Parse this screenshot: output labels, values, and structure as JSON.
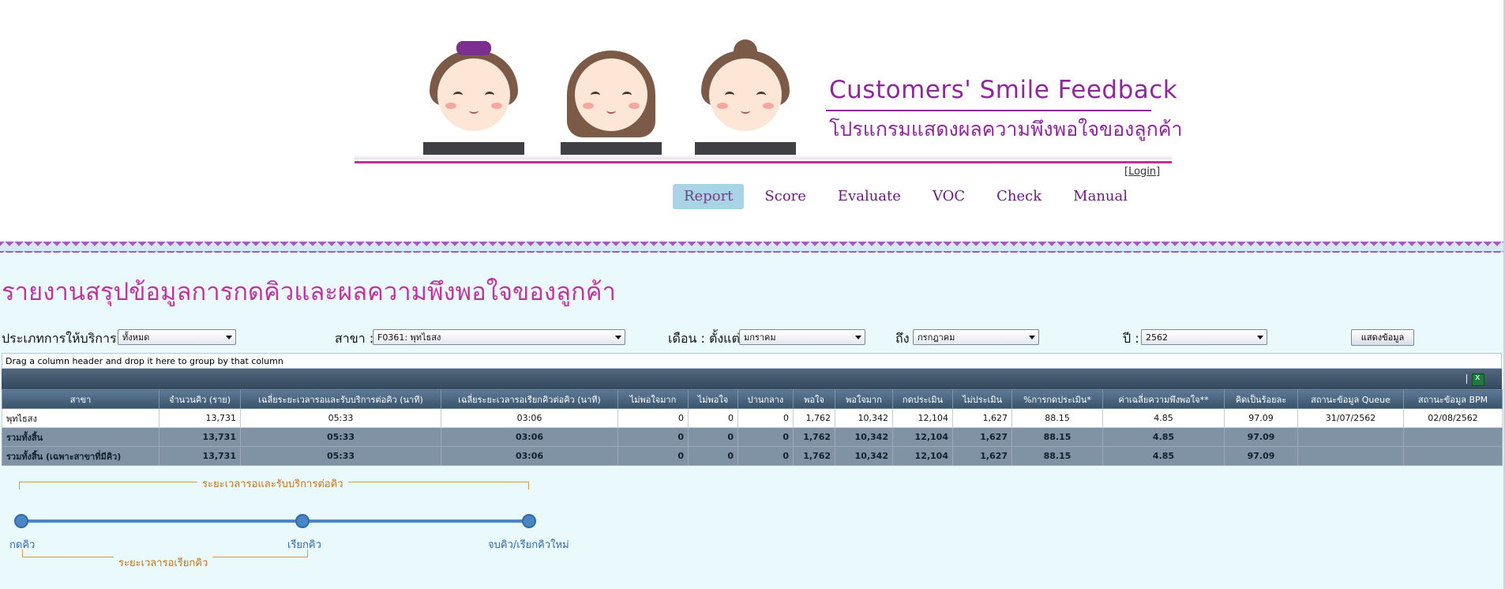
{
  "brand": {
    "title": "Customers' Smile Feedback",
    "subtitle": "โปรแกรมแสดงผลความพึงพอใจของลูกค้า"
  },
  "login": {
    "label": "Login"
  },
  "nav": [
    {
      "label": "Report",
      "active": true
    },
    {
      "label": "Score",
      "active": false
    },
    {
      "label": "Evaluate",
      "active": false
    },
    {
      "label": "VOC",
      "active": false
    },
    {
      "label": "Check",
      "active": false
    },
    {
      "label": "Manual",
      "active": false
    }
  ],
  "page": {
    "title": "รายงานสรุปข้อมูลการกดคิวและผลความพึงพอใจของลูกค้า"
  },
  "filters": {
    "service_type_label": "ประเภทการให้บริการ :",
    "service_type_value": "ทั้งหมด",
    "branch_label": "สาขา :",
    "branch_value": "F0361: พุทไธสง",
    "month_from_label": "เดือน : ตั้งแต่",
    "month_from_value": "มกราคม",
    "month_to_label": "ถึง",
    "month_to_value": "กรกฎาคม",
    "year_label": "ปี :",
    "year_value": "2562",
    "show_button": "แสดงข้อมูล"
  },
  "grid": {
    "group_hint": "Drag a column header and drop it here to group by that column",
    "columns": [
      "สาขา",
      "จำนวนคิว (ราย)",
      "เฉลี่ยระยะเวลารอและรับบริการต่อคิว (นาที)",
      "เฉลี่ยระยะเวลารอเรียกคิวต่อคิว (นาที)",
      "ไม่พอใจมาก",
      "ไม่พอใจ",
      "ปานกลาง",
      "พอใจ",
      "พอใจมาก",
      "กดประเมิน",
      "ไม่ประเมิน",
      "%การกดประเมิน*",
      "ค่าเฉลี่ยความพึงพอใจ**",
      "คิดเป็นร้อยละ",
      "สถานะข้อมูล Queue",
      "สถานะข้อมูล BPM"
    ],
    "rows": [
      [
        "พุทไธสง",
        "13,731",
        "05:33",
        "03:06",
        "0",
        "0",
        "0",
        "1,762",
        "10,342",
        "12,104",
        "1,627",
        "88.15",
        "4.85",
        "97.09",
        "31/07/2562",
        "02/08/2562"
      ]
    ],
    "summary_rows": [
      [
        "รวมทั้งสิ้น",
        "13,731",
        "05:33",
        "03:06",
        "0",
        "0",
        "0",
        "1,762",
        "10,342",
        "12,104",
        "1,627",
        "88.15",
        "4.85",
        "97.09",
        "",
        ""
      ],
      [
        "รวมทั้งสิ้น (เฉพาะสาขาที่มีคิว)",
        "13,731",
        "05:33",
        "03:06",
        "0",
        "0",
        "0",
        "1,762",
        "10,342",
        "12,104",
        "1,627",
        "88.15",
        "4.85",
        "97.09",
        "",
        ""
      ]
    ]
  },
  "timeline": {
    "top_label": "ระยะเวลารอและรับบริการต่อคิว",
    "bottom_label": "ระยะเวลารอเรียกคิว",
    "points": [
      "กดคิว",
      "เรียกคิว",
      "จบคิว/เรียกคิวใหม่"
    ]
  },
  "colors": {
    "brand": "#8b2b97",
    "title": "#c0359e",
    "nav_active_bg": "#a9d4e5",
    "grid_header": "#3a536b",
    "timeline_line": "#4a86c5",
    "timeline_bracket": "#d9994a"
  }
}
